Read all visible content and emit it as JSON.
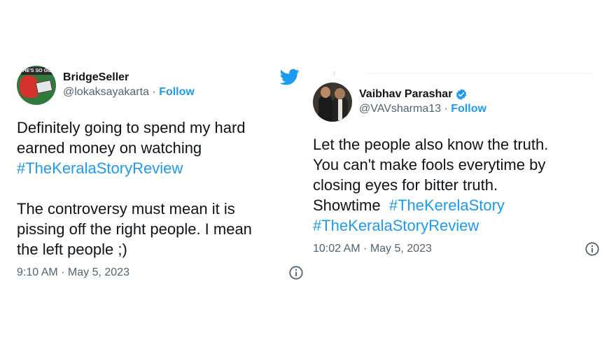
{
  "colors": {
    "accent": "#1d9bf0",
    "text": "#0f1419",
    "muted": "#536471"
  },
  "tweet1": {
    "name": "BridgeSeller",
    "handle": "@lokaksayakarta",
    "sep": " · ",
    "follow": "Follow",
    "avatar_text": "HE'S SO GO LIT FELLA",
    "line1": "Definitely going to spend my hard",
    "line2": "earned money on watching",
    "hashtag": "#TheKeralaStoryReview",
    "line3": "The controversy must mean it is",
    "line4": "pissing off the right people. I mean",
    "line5": "the left people ;)",
    "timestamp": "9:10 AM · May 5, 2023",
    "icons": [
      "twitter-bird-icon",
      "info-icon"
    ]
  },
  "tweet2": {
    "name": "Vaibhav Parashar",
    "handle": "@VAVsharma13",
    "sep": " · ",
    "follow": "Follow",
    "line1": "Let the people also know the truth.",
    "line2": "You can't make fools everytime by",
    "line3": "closing eyes for bitter truth.",
    "line4_prefix": "Showtime  ",
    "hashtag1": "#TheKerelaStory",
    "hashtag2": "#TheKeralaStoryReview",
    "timestamp": "10:02 AM · May 5, 2023",
    "icons": [
      "verified-badge-icon",
      "info-icon"
    ]
  }
}
